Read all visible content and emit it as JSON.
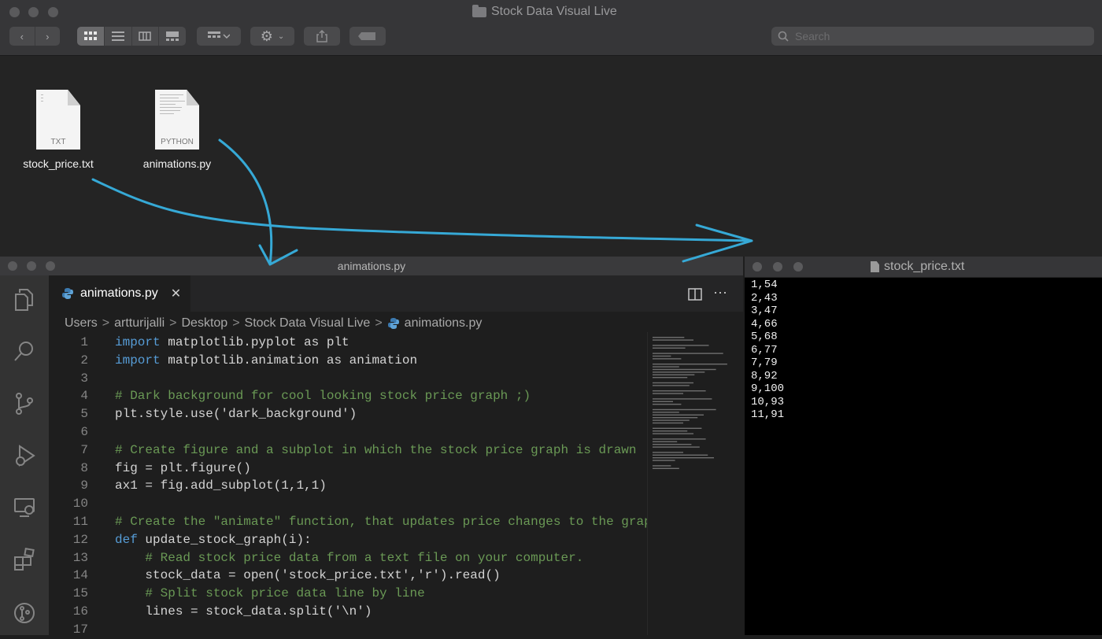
{
  "finder": {
    "title": "Stock Data Visual Live",
    "search_placeholder": "Search",
    "files": [
      {
        "name": "stock_price.txt",
        "kind": "TXT"
      },
      {
        "name": "animations.py",
        "kind": "PYTHON"
      }
    ]
  },
  "vscode": {
    "window_title": "animations.py",
    "tab_label": "animations.py",
    "tab_close": "✕",
    "breadcrumb": [
      "Users",
      "artturijalli",
      "Desktop",
      "Stock Data Visual Live",
      "animations.py"
    ],
    "breadcrumb_sep": ">",
    "code_lines": [
      {
        "n": "1",
        "text": "import matplotlib.pyplot as plt"
      },
      {
        "n": "2",
        "text": "import matplotlib.animation as animation"
      },
      {
        "n": "3",
        "text": ""
      },
      {
        "n": "4",
        "text": "# Dark background for cool looking stock price graph ;)"
      },
      {
        "n": "5",
        "text": "plt.style.use('dark_background')"
      },
      {
        "n": "6",
        "text": ""
      },
      {
        "n": "7",
        "text": "# Create figure and a subplot in which the stock price graph is drawn"
      },
      {
        "n": "8",
        "text": "fig = plt.figure()"
      },
      {
        "n": "9",
        "text": "ax1 = fig.add_subplot(1,1,1)"
      },
      {
        "n": "10",
        "text": ""
      },
      {
        "n": "11",
        "text": "# Create the \"animate\" function, that updates price changes to the graph."
      },
      {
        "n": "12",
        "text": "def update_stock_graph(i):"
      },
      {
        "n": "13",
        "text": "    # Read stock price data from a text file on your computer."
      },
      {
        "n": "14",
        "text": "    stock_data = open('stock_price.txt','r').read()"
      },
      {
        "n": "15",
        "text": "    # Split stock price data line by line"
      },
      {
        "n": "16",
        "text": "    lines = stock_data.split('\\n')"
      },
      {
        "n": "17",
        "text": ""
      }
    ]
  },
  "textfile": {
    "title": "stock_price.txt",
    "rows": [
      "1,54",
      "2,43",
      "3,47",
      "4,66",
      "5,68",
      "6,77",
      "7,79",
      "8,92",
      "9,100",
      "10,93",
      "11,91"
    ]
  },
  "colors": {
    "annotation": "#36a9d6",
    "keyword": "#569cd6",
    "comment": "#6a9955"
  },
  "icons": {
    "activity_bar": [
      "files-icon",
      "search-icon",
      "source-control-icon",
      "run-debug-icon",
      "remote-explorer-icon",
      "extensions-icon",
      "git-graph-icon"
    ]
  }
}
